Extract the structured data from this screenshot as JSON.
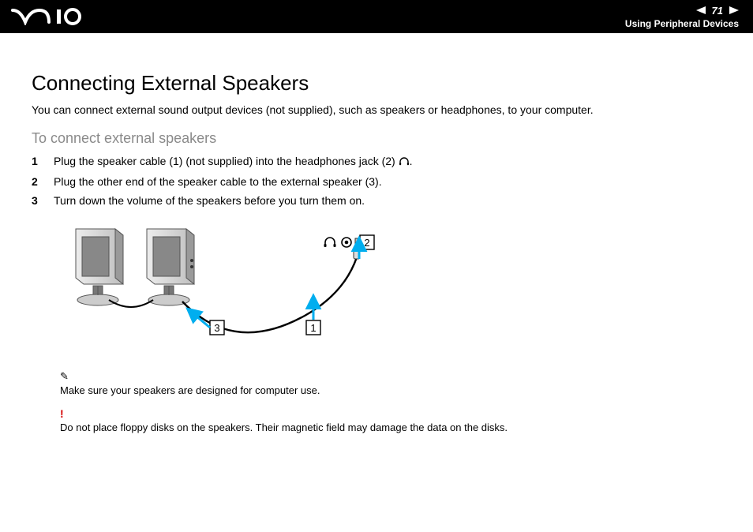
{
  "header": {
    "page_number": "71",
    "section": "Using Peripheral Devices"
  },
  "title": "Connecting External Speakers",
  "intro": "You can connect external sound output devices (not supplied), such as speakers or headphones, to your computer.",
  "subheading": "To connect external speakers",
  "steps": [
    {
      "num": "1",
      "text_a": "Plug the speaker cable (1) (not supplied) into the headphones jack (2) ",
      "text_b": "."
    },
    {
      "num": "2",
      "text": "Plug the other end of the speaker cable to the external speaker (3)."
    },
    {
      "num": "3",
      "text": "Turn down the volume of the speakers before you turn them on."
    }
  ],
  "callouts": {
    "c1": "1",
    "c2": "2",
    "c3": "3"
  },
  "notes": {
    "note_icon": "✎",
    "note_text": "Make sure your speakers are designed for computer use.",
    "warn_mark": "!",
    "warn_text": "Do not place floppy disks on the speakers. Their magnetic field may damage the data on the disks."
  }
}
